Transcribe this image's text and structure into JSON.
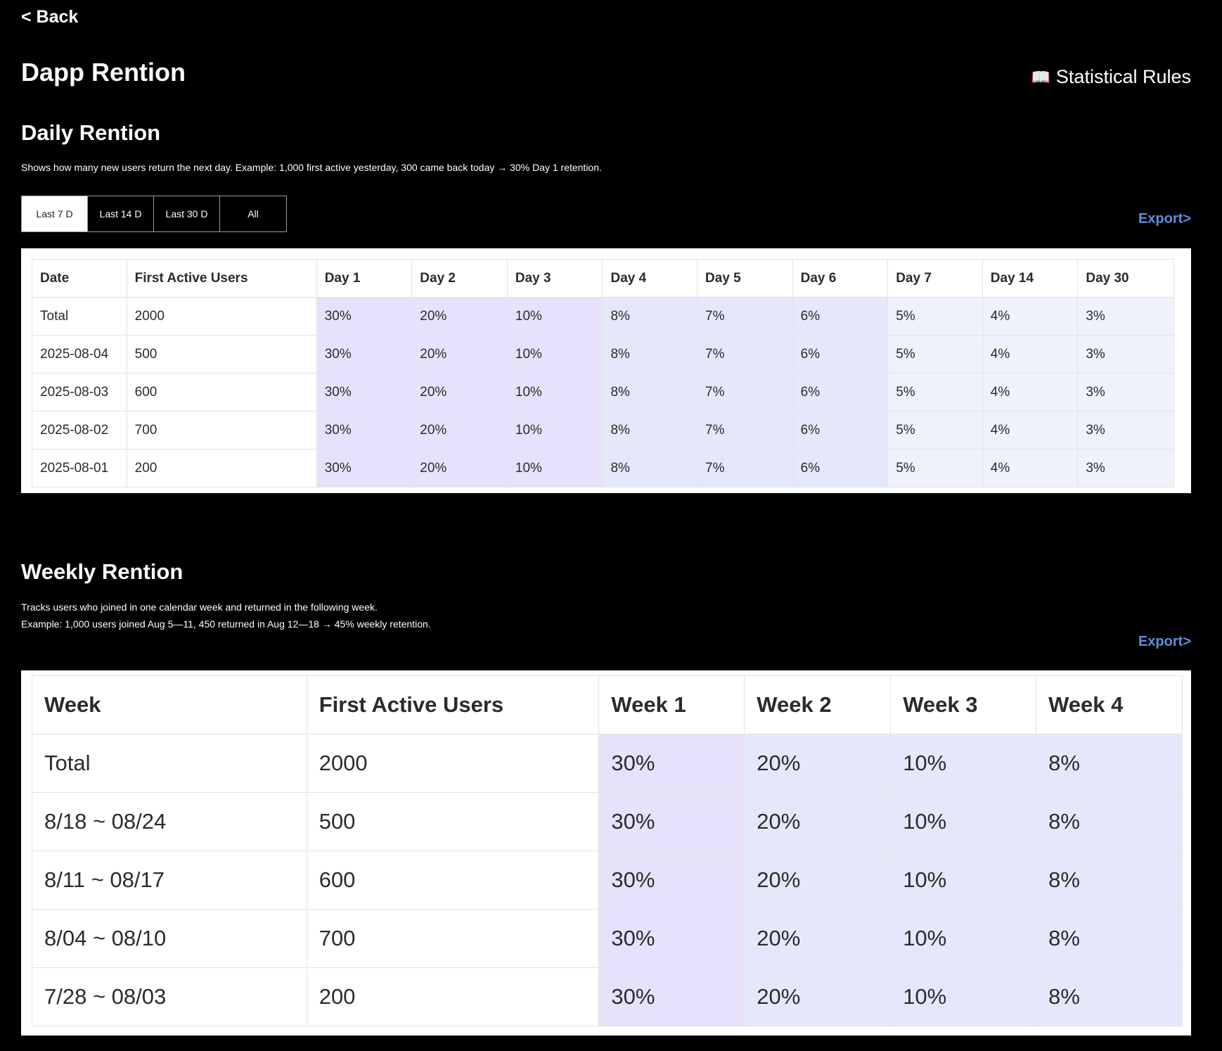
{
  "nav": {
    "back_label": "< Back"
  },
  "page": {
    "title": "Dapp Rention",
    "rules_label": "Statistical Rules",
    "rules_icon": "book-icon"
  },
  "daily": {
    "title": "Daily Rention",
    "description": "Shows how many new users return the next day. Example: 1,000 first active yesterday, 300 came back today → 30% Day 1 retention.",
    "tabs": [
      {
        "label": "Last 7 D",
        "active": true
      },
      {
        "label": "Last 14 D",
        "active": false
      },
      {
        "label": "Last 30 D",
        "active": false
      },
      {
        "label": "All",
        "active": false
      }
    ],
    "export_label": "Export>",
    "headers": [
      "Date",
      "First Active Users",
      "Day 1",
      "Day 2",
      "Day 3",
      "Day 4",
      "Day 5",
      "Day 6",
      "Day 7",
      "Day 14",
      "Day 30"
    ],
    "rows": [
      [
        "Total",
        "2000",
        "30%",
        "20%",
        "10%",
        "8%",
        "7%",
        "6%",
        "5%",
        "4%",
        "3%"
      ],
      [
        "2025-08-04",
        "500",
        "30%",
        "20%",
        "10%",
        "8%",
        "7%",
        "6%",
        "5%",
        "4%",
        "3%"
      ],
      [
        "2025-08-03",
        "600",
        "30%",
        "20%",
        "10%",
        "8%",
        "7%",
        "6%",
        "5%",
        "4%",
        "3%"
      ],
      [
        "2025-08-02",
        "700",
        "30%",
        "20%",
        "10%",
        "8%",
        "7%",
        "6%",
        "5%",
        "4%",
        "3%"
      ],
      [
        "2025-08-01",
        "200",
        "30%",
        "20%",
        "10%",
        "8%",
        "7%",
        "6%",
        "5%",
        "4%",
        "3%"
      ]
    ]
  },
  "weekly": {
    "title": "Weekly Rention",
    "description_line1": "Tracks users who joined in one calendar week and returned in the following week.",
    "description_line2": "Example: 1,000 users joined Aug 5—11, 450 returned in Aug 12—18 → 45% weekly retention.",
    "export_label": "Export>",
    "headers": [
      "Week",
      "First Active Users",
      "Week 1",
      "Week 2",
      "Week 3",
      "Week 4"
    ],
    "rows": [
      [
        "Total",
        "2000",
        "30%",
        "20%",
        "10%",
        "8%"
      ],
      [
        "8/18 ~ 08/24",
        "500",
        "30%",
        "20%",
        "10%",
        "8%"
      ],
      [
        "8/11 ~ 08/17",
        "600",
        "30%",
        "20%",
        "10%",
        "8%"
      ],
      [
        "8/04 ~ 08/10",
        "700",
        "30%",
        "20%",
        "10%",
        "8%"
      ],
      [
        "7/28 ~ 08/03",
        "200",
        "30%",
        "20%",
        "10%",
        "8%"
      ]
    ]
  },
  "colors": {
    "background": "#000000",
    "export_link": "#5b8fd9",
    "cell_purple": "#e8e1fb",
    "cell_blue": "#e5e8fb",
    "cell_light": "#eff1fd"
  }
}
